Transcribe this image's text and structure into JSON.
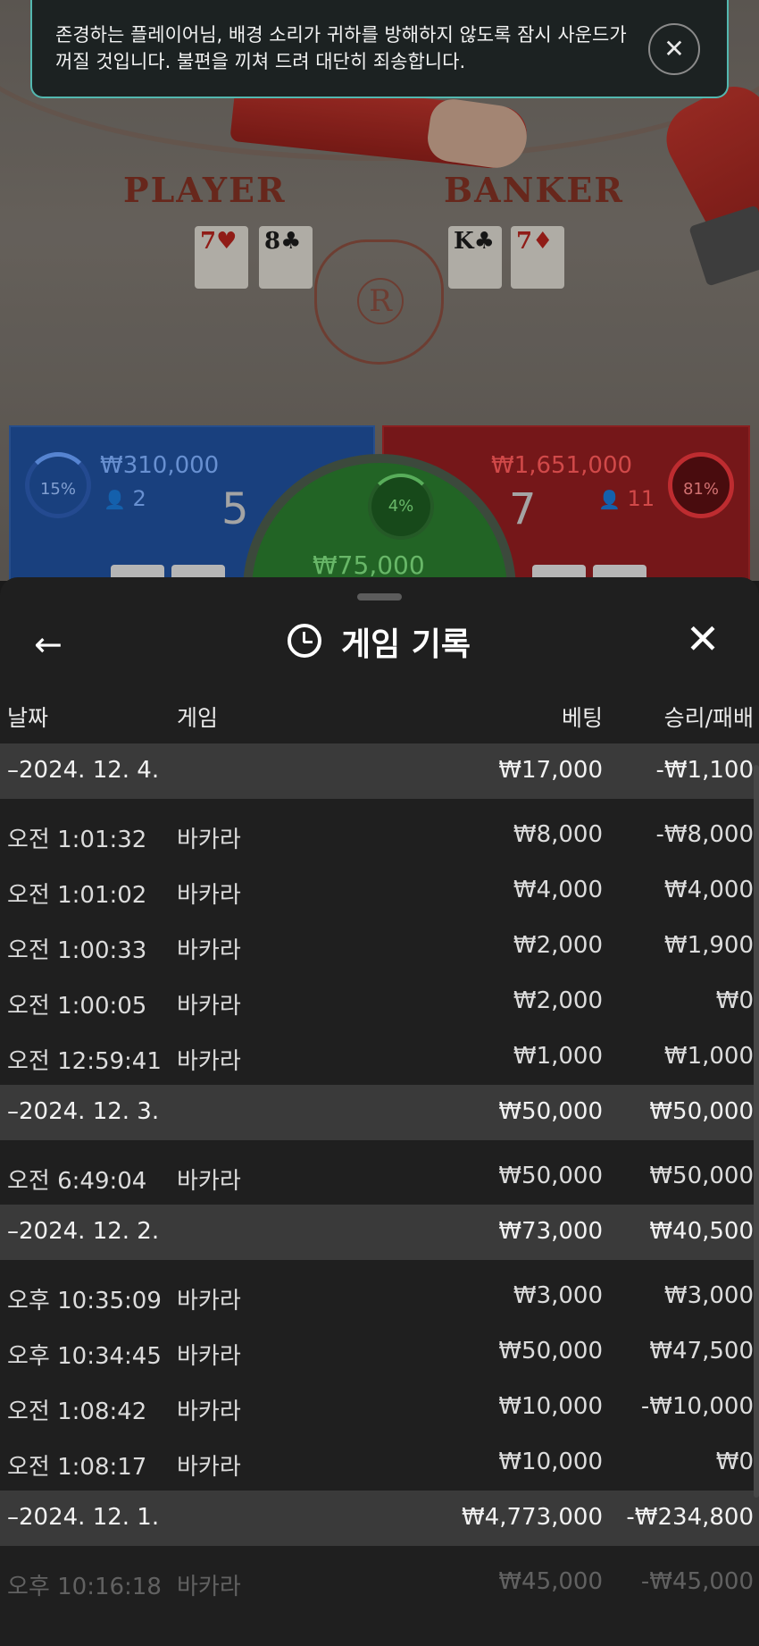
{
  "toast": {
    "message": "존경하는 플레이어님, 배경 소리가 귀하를 방해하지 않도록 잠시 사운드가 꺼질 것입니다. 불편을 끼쳐 드려 대단히 죄송합니다.",
    "close_glyph": "✕"
  },
  "table": {
    "player_label": "PLAYER",
    "banker_label": "BANKER",
    "player_cards": [
      "7♥",
      "8♣"
    ],
    "banker_cards": [
      "K♣",
      "7♦"
    ],
    "logo_letter": "R"
  },
  "bets": {
    "player": {
      "percent": "15%",
      "amount": "₩310,000",
      "count": "2",
      "score": "5"
    },
    "banker": {
      "percent": "81%",
      "amount": "₩1,651,000",
      "count": "11",
      "score": "7"
    },
    "tie": {
      "percent": "4%",
      "amount": "₩75,000"
    }
  },
  "history": {
    "title": "게임 기록",
    "columns": {
      "date": "날짜",
      "game": "게임",
      "bet": "베팅",
      "result": "승리/패배"
    },
    "groups": [
      {
        "date": "–2024. 12. 4.",
        "bet": "₩17,000",
        "result": "-₩1,100",
        "rows": [
          {
            "time": "오전 1:01:32",
            "game": "바카라",
            "bet": "₩8,000",
            "result": "-₩8,000"
          },
          {
            "time": "오전 1:01:02",
            "game": "바카라",
            "bet": "₩4,000",
            "result": "₩4,000"
          },
          {
            "time": "오전 1:00:33",
            "game": "바카라",
            "bet": "₩2,000",
            "result": "₩1,900"
          },
          {
            "time": "오전 1:00:05",
            "game": "바카라",
            "bet": "₩2,000",
            "result": "₩0"
          },
          {
            "time": "오전 12:59:41",
            "game": "바카라",
            "bet": "₩1,000",
            "result": "₩1,000"
          }
        ]
      },
      {
        "date": "–2024. 12. 3.",
        "bet": "₩50,000",
        "result": "₩50,000",
        "rows": [
          {
            "time": "오전 6:49:04",
            "game": "바카라",
            "bet": "₩50,000",
            "result": "₩50,000"
          }
        ]
      },
      {
        "date": "–2024. 12. 2.",
        "bet": "₩73,000",
        "result": "₩40,500",
        "rows": [
          {
            "time": "오후 10:35:09",
            "game": "바카라",
            "bet": "₩3,000",
            "result": "₩3,000"
          },
          {
            "time": "오후 10:34:45",
            "game": "바카라",
            "bet": "₩50,000",
            "result": "₩47,500"
          },
          {
            "time": "오전 1:08:42",
            "game": "바카라",
            "bet": "₩10,000",
            "result": "-₩10,000"
          },
          {
            "time": "오전 1:08:17",
            "game": "바카라",
            "bet": "₩10,000",
            "result": "₩0"
          }
        ]
      },
      {
        "date": "–2024. 12. 1.",
        "bet": "₩4,773,000",
        "result": "-₩234,800",
        "rows": [
          {
            "time": "오후 10:16:18",
            "game": "바카라",
            "bet": "₩45,000",
            "result": "-₩45,000"
          }
        ]
      }
    ]
  },
  "icons": {
    "back": "←",
    "close": "✕",
    "history": "history-icon",
    "user": "👤"
  }
}
